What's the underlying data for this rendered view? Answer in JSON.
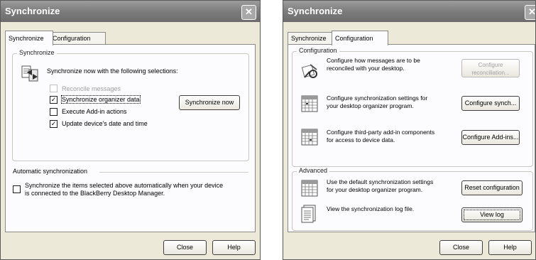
{
  "left_window": {
    "title": "Synchronize",
    "close_glyph": "✕",
    "tabs": [
      "Synchronize",
      "Configuration"
    ],
    "active_tab": "Synchronize",
    "sync_group": {
      "legend": "Synchronize",
      "intro": "Synchronize now with the following selections:",
      "options": [
        {
          "label": "Reconcile messages",
          "checked": false,
          "disabled": true
        },
        {
          "label": "Synchronize organizer data",
          "checked": true,
          "disabled": false
        },
        {
          "label": "Execute Add-in actions",
          "checked": false,
          "disabled": false
        },
        {
          "label": "Update device's date and time",
          "checked": true,
          "disabled": false
        }
      ],
      "sync_now_label": "Synchronize now"
    },
    "auto_group": {
      "legend": "Automatic synchronization",
      "checkbox_checked": false,
      "checkbox_label_line1": "Synchronize the items selected above automatically when your device",
      "checkbox_label_line2": "is connected to the BlackBerry Desktop Manager."
    },
    "footer": {
      "close_label": "Close",
      "help_label": "Help"
    }
  },
  "right_window": {
    "title": "Synchronize",
    "close_glyph": "✕",
    "tabs": [
      "Synchronize",
      "Configuration"
    ],
    "active_tab": "Configuration",
    "configuration_group": {
      "legend": "Configuration",
      "rows": [
        {
          "line1": "Configure how messages are to be",
          "line2": "reconciled with your desktop.",
          "button_line1": "Configure",
          "button_line2": "reconciliation...",
          "button_disabled": true,
          "icon": "tools-icon"
        },
        {
          "line1": "Configure synchronization settings for",
          "line2": "your desktop organizer program.",
          "button": "Configure synch...",
          "icon": "calendar-icon"
        },
        {
          "line1": "Configure third-party add-in components",
          "line2": "for access to device data.",
          "button": "Configure Add-ins...",
          "icon": "calendar-icon"
        }
      ]
    },
    "advanced_group": {
      "legend": "Advanced",
      "rows": [
        {
          "line1": "Use the default synchronization settings",
          "line2": "for your desktop organizer program.",
          "button": "Reset configuration",
          "icon": "calendar-icon"
        },
        {
          "line1": "View the synchronization log file.",
          "line2": "",
          "button": "View log",
          "icon": "log-file-icon"
        }
      ]
    },
    "footer": {
      "close_label": "Close",
      "help_label": "Help"
    }
  }
}
